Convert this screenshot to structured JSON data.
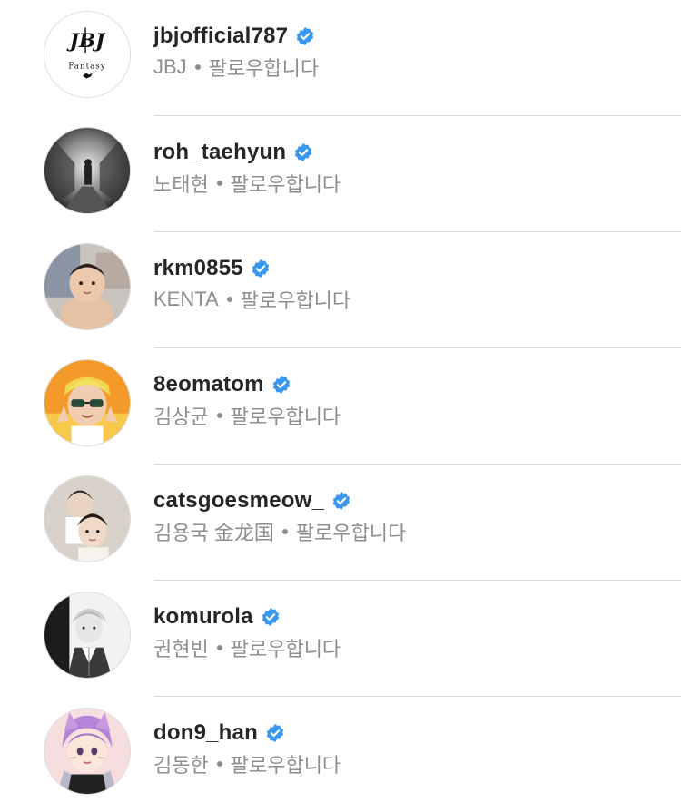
{
  "colors": {
    "username": "#262626",
    "secondary": "#8e8e8e",
    "verified_badge": "#3897f0",
    "divider": "#dbdbdb"
  },
  "accounts": [
    {
      "username": "jbjofficial787",
      "display_name": "JBJ",
      "status": "팔로우합니다",
      "verified": true,
      "avatar_icon": "jbj-fantasy-logo-icon",
      "avatar_text": "Fantasy"
    },
    {
      "username": "roh_taehyun",
      "display_name": "노태현",
      "status": "팔로우합니다",
      "verified": true,
      "avatar_icon": "tunnel-photo-icon"
    },
    {
      "username": "rkm0855",
      "display_name": "KENTA",
      "status": "팔로우합니다",
      "verified": true,
      "avatar_icon": "baby-photo-icon"
    },
    {
      "username": "8eomatom",
      "display_name": "김상균",
      "status": "팔로우합니다",
      "verified": true,
      "avatar_icon": "sunglasses-portrait-icon"
    },
    {
      "username": "catsgoesmeow_",
      "display_name": "김용국 金龙国",
      "status": "팔로우합니다",
      "verified": true,
      "avatar_icon": "two-people-photo-icon"
    },
    {
      "username": "komurola",
      "display_name": "권현빈",
      "status": "팔로우합니다",
      "verified": true,
      "avatar_icon": "monochrome-portrait-icon"
    },
    {
      "username": "don9_han",
      "display_name": "김동한",
      "status": "팔로우합니다",
      "verified": true,
      "avatar_icon": "cartoon-avatar-icon"
    }
  ]
}
